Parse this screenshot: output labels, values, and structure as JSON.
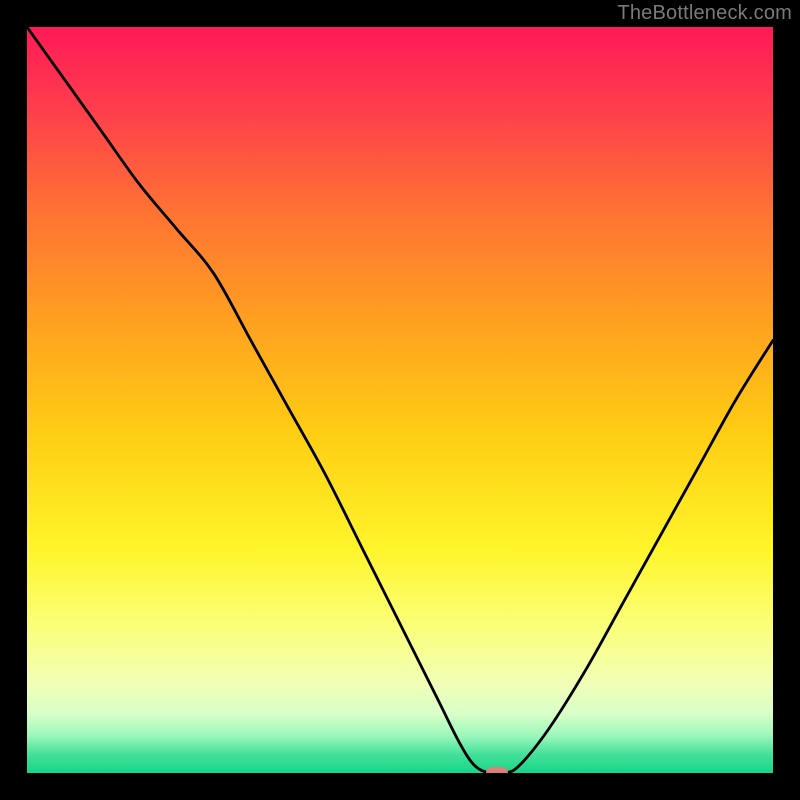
{
  "watermark": "TheBottleneck.com",
  "chart_data": {
    "type": "line",
    "title": "",
    "xlabel": "",
    "ylabel": "",
    "xlim": [
      0,
      100
    ],
    "ylim": [
      0,
      100
    ],
    "grid": false,
    "legend": false,
    "gradient_stops": [
      {
        "pct": 0,
        "color": "#ff1a57"
      },
      {
        "pct": 10,
        "color": "#ff3a4e"
      },
      {
        "pct": 25,
        "color": "#ff7333"
      },
      {
        "pct": 40,
        "color": "#ffa21f"
      },
      {
        "pct": 55,
        "color": "#ffcf13"
      },
      {
        "pct": 70,
        "color": "#fff52a"
      },
      {
        "pct": 80,
        "color": "#fbff77"
      },
      {
        "pct": 88,
        "color": "#f1ffb6"
      },
      {
        "pct": 92,
        "color": "#d9ffc8"
      },
      {
        "pct": 95,
        "color": "#9cf7bb"
      },
      {
        "pct": 97.5,
        "color": "#44e09a"
      },
      {
        "pct": 100,
        "color": "#14d688"
      }
    ],
    "series": [
      {
        "name": "bottleneck-curve",
        "color": "#000000",
        "stroke_width": 2.8,
        "x": [
          0,
          5,
          10,
          15,
          20,
          25,
          30,
          35,
          40,
          45,
          50,
          55,
          58,
          60,
          62,
          64,
          66,
          70,
          75,
          80,
          85,
          90,
          95,
          100
        ],
        "y": [
          100,
          93,
          86,
          79,
          73,
          67,
          58,
          49,
          40,
          30,
          20,
          10,
          4,
          1,
          0,
          0,
          1,
          6,
          14,
          23,
          32,
          41,
          50,
          58
        ]
      }
    ],
    "marker": {
      "x": 63,
      "y": 0,
      "color": "#db7f7c",
      "shape": "pill"
    }
  }
}
